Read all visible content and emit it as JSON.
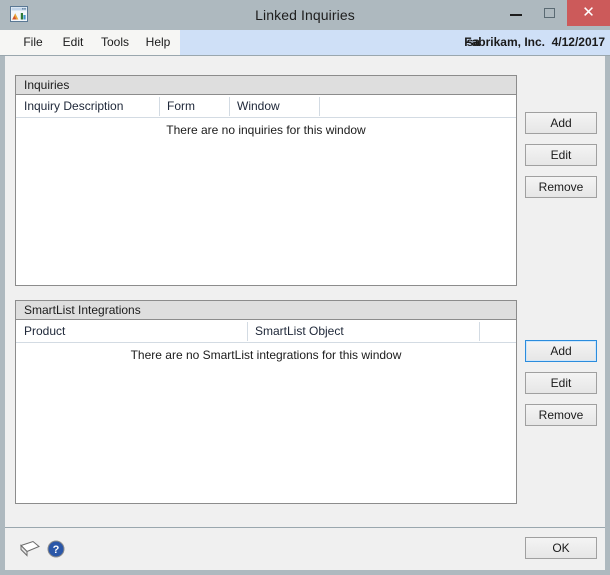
{
  "window": {
    "title": "Linked Inquiries",
    "app_icon": "window-chart-icon",
    "controls": {
      "minimize_label": "–",
      "maximize_label": "",
      "close_label": "✕",
      "close_color": "#cc5a5a"
    },
    "titlebar_color": "#aeb9bf",
    "client_color": "#f0f0f0"
  },
  "menu": {
    "items": [
      {
        "label": "File"
      },
      {
        "label": "Edit"
      },
      {
        "label": "Tools"
      },
      {
        "label": "Help"
      }
    ],
    "strip_color": "#cfe0f7"
  },
  "status": {
    "user": "sa",
    "company": "Fabrikam, Inc.",
    "date": "4/12/2017"
  },
  "inquiries_panel": {
    "caption": "Inquiries",
    "columns": [
      {
        "label": "Inquiry Description"
      },
      {
        "label": "Form"
      },
      {
        "label": "Window"
      },
      {
        "label": ""
      }
    ],
    "empty_message": "There are no inquiries for this window",
    "rows": [],
    "buttons": [
      {
        "label": "Add",
        "focused": false
      },
      {
        "label": "Edit",
        "focused": false
      },
      {
        "label": "Remove",
        "focused": false
      }
    ]
  },
  "smartlist_panel": {
    "caption": "SmartList Integrations",
    "columns": [
      {
        "label": "Product"
      },
      {
        "label": "SmartList Object"
      },
      {
        "label": ""
      }
    ],
    "empty_message": "There are no SmartList integrations for this window",
    "rows": [],
    "buttons": [
      {
        "label": "Add",
        "focused": true
      },
      {
        "label": "Edit",
        "focused": false
      },
      {
        "label": "Remove",
        "focused": false
      }
    ]
  },
  "bottom_bar": {
    "note_icon": "note-icon",
    "help_icon": "help-question-icon",
    "ok_label": "OK",
    "focus_color": "#2a8cdd"
  }
}
